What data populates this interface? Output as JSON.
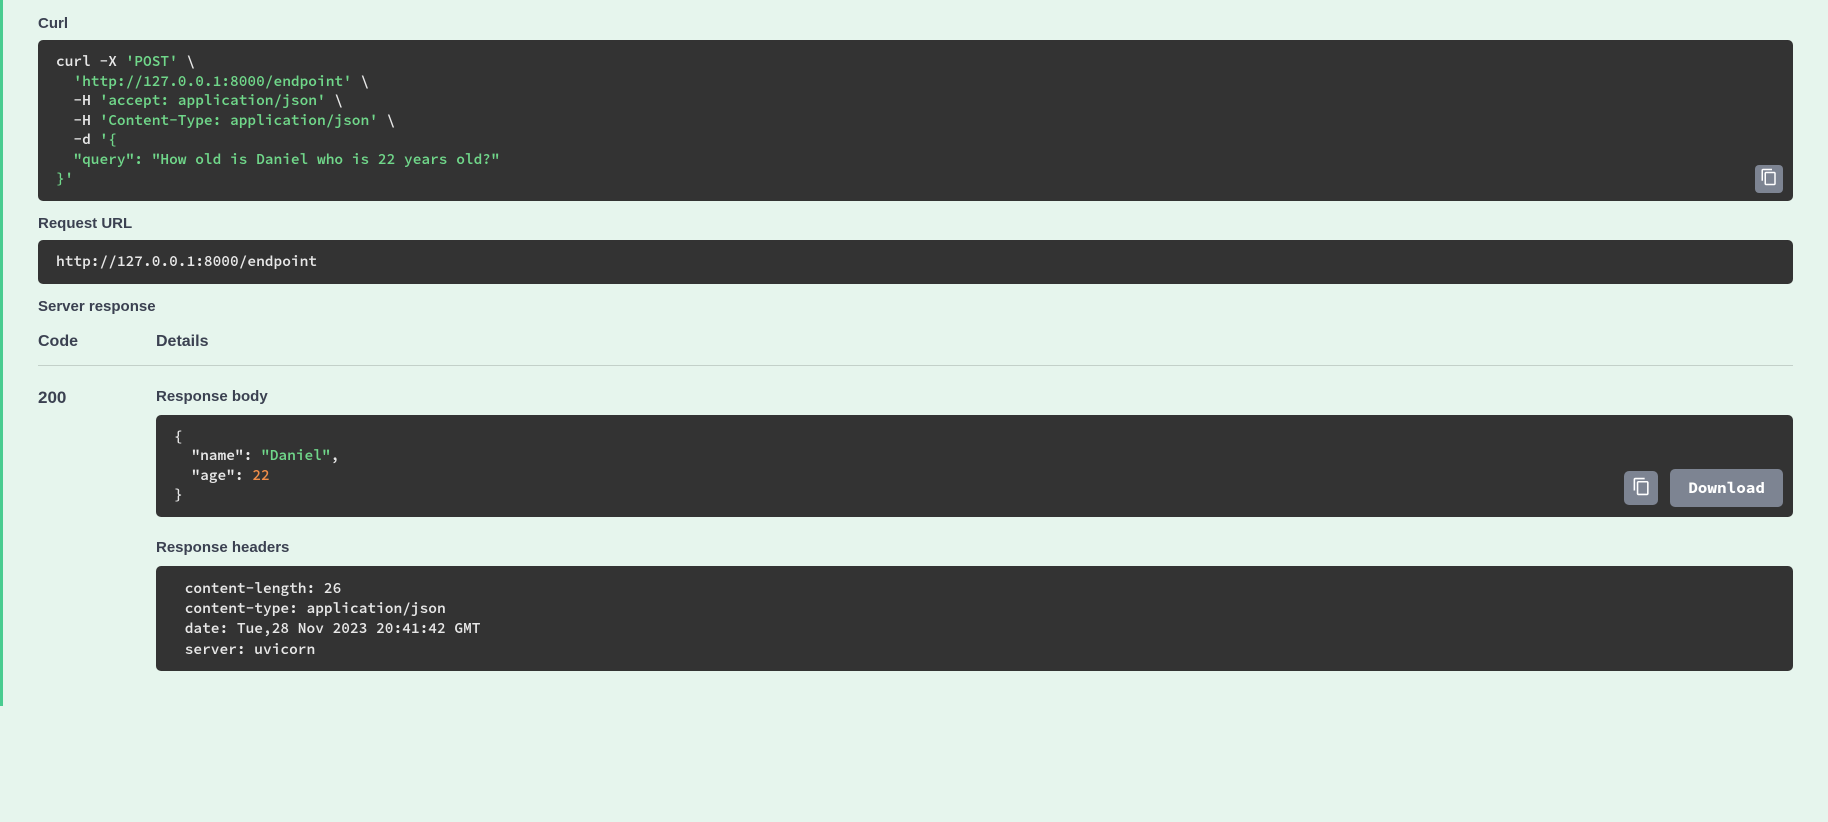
{
  "labels": {
    "curl": "Curl",
    "request_url": "Request URL",
    "server_response": "Server response",
    "code": "Code",
    "details": "Details",
    "response_body": "Response body",
    "response_headers": "Response headers",
    "download": "Download"
  },
  "curl": {
    "l0a": "curl -X ",
    "l0b": "'POST'",
    "l0c": " \\",
    "l1a": "  ",
    "l1b": "'http://127.0.0.1:8000/endpoint'",
    "l1c": " \\",
    "l2a": "  -H ",
    "l2b": "'accept: application/json'",
    "l2c": " \\",
    "l3a": "  -H ",
    "l3b": "'Content-Type: application/json'",
    "l3c": " \\",
    "l4a": "  -d ",
    "l4b": "'{",
    "l5a": "  \"query\": \"How old is Daniel who is 22 years old?\"",
    "l6a": "}'"
  },
  "request_url": "http://127.0.0.1:8000/endpoint",
  "response": {
    "status_code": "200",
    "body": {
      "l0": "{",
      "l1a": "  ",
      "l1b": "\"name\"",
      "l1c": ": ",
      "l1d": "\"Daniel\"",
      "l1e": ",",
      "l2a": "  ",
      "l2b": "\"age\"",
      "l2c": ": ",
      "l2d": "22",
      "l3": "}"
    },
    "headers": {
      "l0": " content-length: 26 ",
      "l1": " content-type: application/json ",
      "l2": " date: Tue,28 Nov 2023 20:41:42 GMT ",
      "l3": " server: uvicorn "
    }
  }
}
